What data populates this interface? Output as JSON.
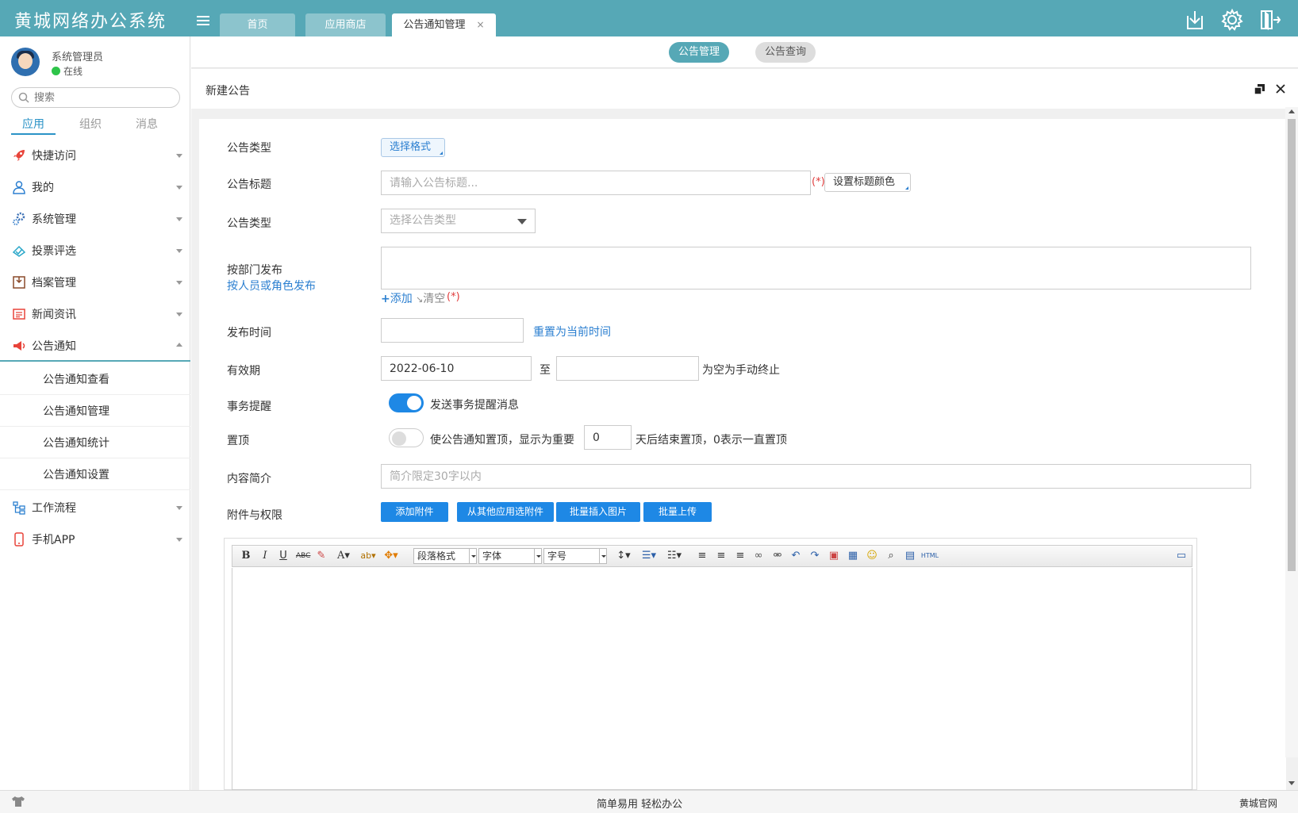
{
  "app": {
    "title": "黄城网络办公系统"
  },
  "tabs": [
    {
      "label": "首页"
    },
    {
      "label": "应用商店"
    },
    {
      "label": "公告通知管理",
      "close": "×"
    }
  ],
  "user": {
    "name": "系统管理员",
    "status": "在线"
  },
  "search": {
    "placeholder": "搜索"
  },
  "side_tabs": [
    "应用",
    "组织",
    "消息"
  ],
  "nav": [
    {
      "label": "快捷访问",
      "icon": "rocket-icon"
    },
    {
      "label": "我的",
      "icon": "user-icon"
    },
    {
      "label": "系统管理",
      "icon": "gears-icon"
    },
    {
      "label": "投票评选",
      "icon": "vote-icon"
    },
    {
      "label": "档案管理",
      "icon": "archive-icon"
    },
    {
      "label": "新闻资讯",
      "icon": "news-icon"
    },
    {
      "label": "公告通知",
      "icon": "megaphone-icon"
    },
    {
      "label": "工作流程",
      "icon": "workflow-icon"
    },
    {
      "label": "手机APP",
      "icon": "phone-icon"
    }
  ],
  "sub_nav": [
    "公告通知查看",
    "公告通知管理",
    "公告通知统计",
    "公告通知设置"
  ],
  "subnav_pills": {
    "active": "公告管理",
    "inactive": "公告查询"
  },
  "panel": {
    "title": "新建公告"
  },
  "form": {
    "type_label": "公告类型",
    "format_btn": "选择格式",
    "title_label": "公告标题",
    "title_placeholder": "请输入公告标题...",
    "required_mark": "(*)",
    "title_color_btn": "设置标题颜色",
    "category_label": "公告类型",
    "category_placeholder": "选择公告类型",
    "dept_label": "按部门发布",
    "person_link": "按人员或角色发布",
    "add_link": "添加",
    "clear_link": "清空",
    "publish_time_label": "发布时间",
    "reset_time_link": "重置为当前时间",
    "valid_label": "有效期",
    "valid_from": "2022-06-10",
    "to_text": "至",
    "valid_hint": "为空为手动终止",
    "remind_label": "事务提醒",
    "remind_text": "发送事务提醒消息",
    "remind_on": true,
    "top_label": "置顶",
    "top_text": "使公告通知置顶，显示为重要",
    "top_days": "0",
    "top_hint": "天后结束置顶，0表示一直置顶",
    "summary_label": "内容简介",
    "summary_placeholder": "简介限定30字以内",
    "attach_label": "附件与权限",
    "attach_buttons": [
      "添加附件",
      "从其他应用选附件",
      "批量插入图片",
      "批量上传"
    ]
  },
  "editor": {
    "paragraph_select": "段落格式",
    "font_select": "字体",
    "size_select": "字号",
    "html_label": "HTML"
  },
  "footer": {
    "slogan": "简单易用 轻松办公",
    "official": "黄城官网"
  },
  "colors": {
    "topbar": "#56a8b6",
    "accent": "#1e88e5",
    "link": "#2b7fd0",
    "required": "#e03c3c"
  }
}
